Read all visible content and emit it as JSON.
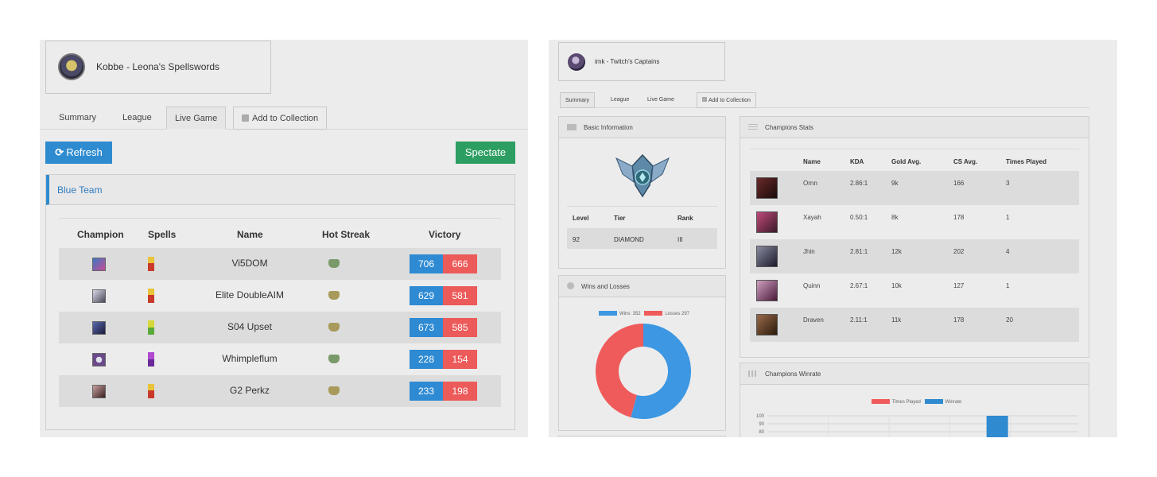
{
  "left": {
    "profile": {
      "name": "Kobbe - Leona's Spellswords"
    },
    "tabs": [
      "Summary",
      "League",
      "Live Game",
      "Add to Collection"
    ],
    "active_tab": "Live Game",
    "refresh_label": "Refresh",
    "spectate_label": "Spectate",
    "team_title": "Blue Team",
    "columns": [
      "Champion",
      "Spells",
      "Name",
      "Hot Streak",
      "Victory"
    ],
    "players": [
      {
        "name": "Vi5DOM",
        "wins": "706",
        "losses": "666"
      },
      {
        "name": "Elite DoubleAIM",
        "wins": "629",
        "losses": "581"
      },
      {
        "name": "S04 Upset",
        "wins": "673",
        "losses": "585"
      },
      {
        "name": "Whimpleflum",
        "wins": "228",
        "losses": "154"
      },
      {
        "name": "G2 Perkz",
        "wins": "233",
        "losses": "198"
      }
    ],
    "colors": {
      "win": "#2e8ad3",
      "loss": "#ec5a5a",
      "spectate": "#2d9e62",
      "refresh": "#2f8bd0"
    }
  },
  "right": {
    "profile": {
      "name": "imk - Twitch's Captains"
    },
    "tabs": [
      "Summary",
      "League",
      "Live Game",
      "Add to Collection"
    ],
    "active_tab": "Summary",
    "basic_info": {
      "title": "Basic Information",
      "headers": [
        "Level",
        "Tier",
        "Rank"
      ],
      "values": [
        "92",
        "DIAMOND",
        "III"
      ]
    },
    "wins_losses": {
      "title": "Wins and Losses",
      "wins_label": "Wins: 352",
      "losses_label": "Losses 297"
    },
    "champion_stats": {
      "title": "Champions Stats",
      "headers": [
        "Name",
        "KDA",
        "Gold Avg.",
        "CS Avg.",
        "Times Played"
      ],
      "rows": [
        {
          "name": "Ornn",
          "kda": "2.86:1",
          "gold": "9k",
          "cs": "166",
          "played": "3"
        },
        {
          "name": "Xayah",
          "kda": "0.50:1",
          "gold": "8k",
          "cs": "178",
          "played": "1"
        },
        {
          "name": "Jhin",
          "kda": "2.81:1",
          "gold": "12k",
          "cs": "202",
          "played": "4"
        },
        {
          "name": "Quinn",
          "kda": "2.67:1",
          "gold": "10k",
          "cs": "127",
          "played": "1"
        },
        {
          "name": "Draven",
          "kda": "2.11:1",
          "gold": "11k",
          "cs": "178",
          "played": "20"
        }
      ]
    },
    "winrate": {
      "title": "Champions Winrate",
      "legend_played": "Times Played",
      "legend_winrate": "Winrate",
      "y_ticks": [
        "100",
        "90",
        "80"
      ]
    }
  },
  "chart_data": [
    {
      "type": "pie",
      "labels": [
        "Wins",
        "Losses"
      ],
      "values": [
        352,
        297
      ],
      "colors": [
        "#3d97e3",
        "#ef5b5b"
      ]
    },
    {
      "type": "bar",
      "series": [
        {
          "name": "Times Played",
          "color": "#ef5b5b"
        },
        {
          "name": "Winrate",
          "color": "#2f8ad0"
        }
      ],
      "ylim": [
        0,
        100
      ],
      "y_ticks": [
        100,
        90,
        80
      ],
      "visible_bar": {
        "series": "Winrate",
        "category_index": 4,
        "value": 100
      }
    }
  ]
}
